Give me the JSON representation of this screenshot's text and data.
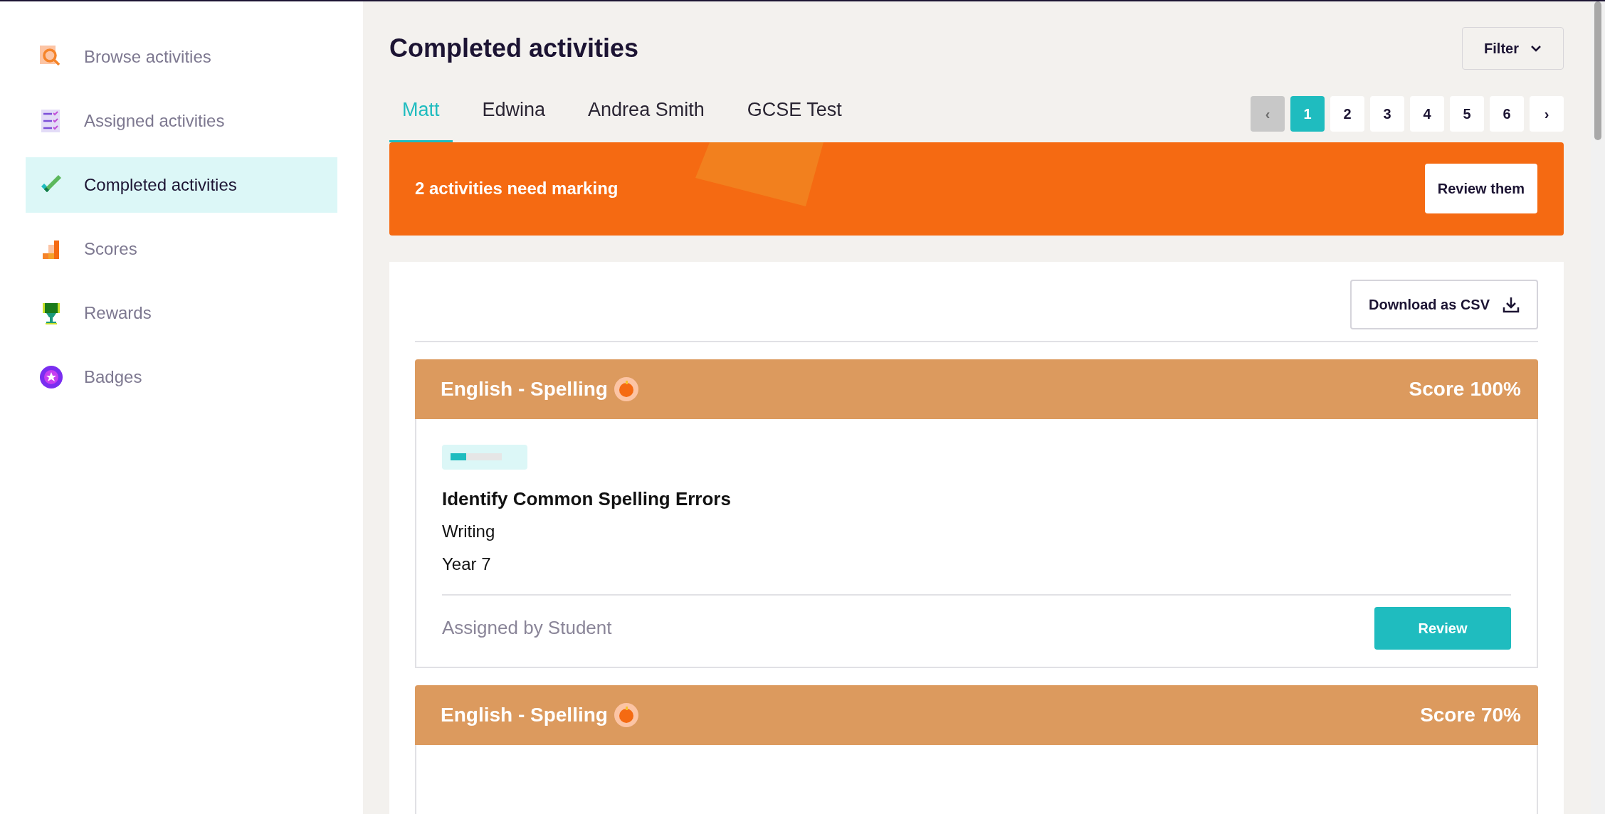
{
  "sidebar": {
    "items": [
      {
        "label": "Browse activities",
        "selected": false
      },
      {
        "label": "Assigned activities",
        "selected": false
      },
      {
        "label": "Completed activities",
        "selected": true
      },
      {
        "label": "Scores",
        "selected": false
      },
      {
        "label": "Rewards",
        "selected": false
      },
      {
        "label": "Badges",
        "selected": false
      }
    ]
  },
  "title": "Completed activities",
  "filter_button": "Filter",
  "tabs": [
    {
      "label": "Matt",
      "selected": true
    },
    {
      "label": "Edwina",
      "selected": false
    },
    {
      "label": "Andrea Smith",
      "selected": false
    },
    {
      "label": "GCSE Test",
      "selected": false
    }
  ],
  "pagination": {
    "prev": "‹",
    "pages": [
      {
        "label": "1",
        "selected": true
      },
      {
        "label": "2",
        "selected": false
      },
      {
        "label": "3",
        "selected": false
      },
      {
        "label": "4",
        "selected": false
      },
      {
        "label": "5",
        "selected": false
      },
      {
        "label": "6",
        "selected": false
      }
    ],
    "next": "›"
  },
  "banner": {
    "message": "2 activities need marking",
    "button": "Review them"
  },
  "download_button": "Download as CSV",
  "activities": [
    {
      "subject": "English - Spelling",
      "score_label": "Score",
      "score": "100%",
      "level": 0.3,
      "title": "Identify Common Spelling Errors",
      "details": [
        "Writing",
        "Year 7"
      ],
      "assigned_by": "Assigned by Student",
      "button": "Review"
    },
    {
      "subject": "English - Spelling",
      "score_label": "Score",
      "score": "70%"
    }
  ]
}
